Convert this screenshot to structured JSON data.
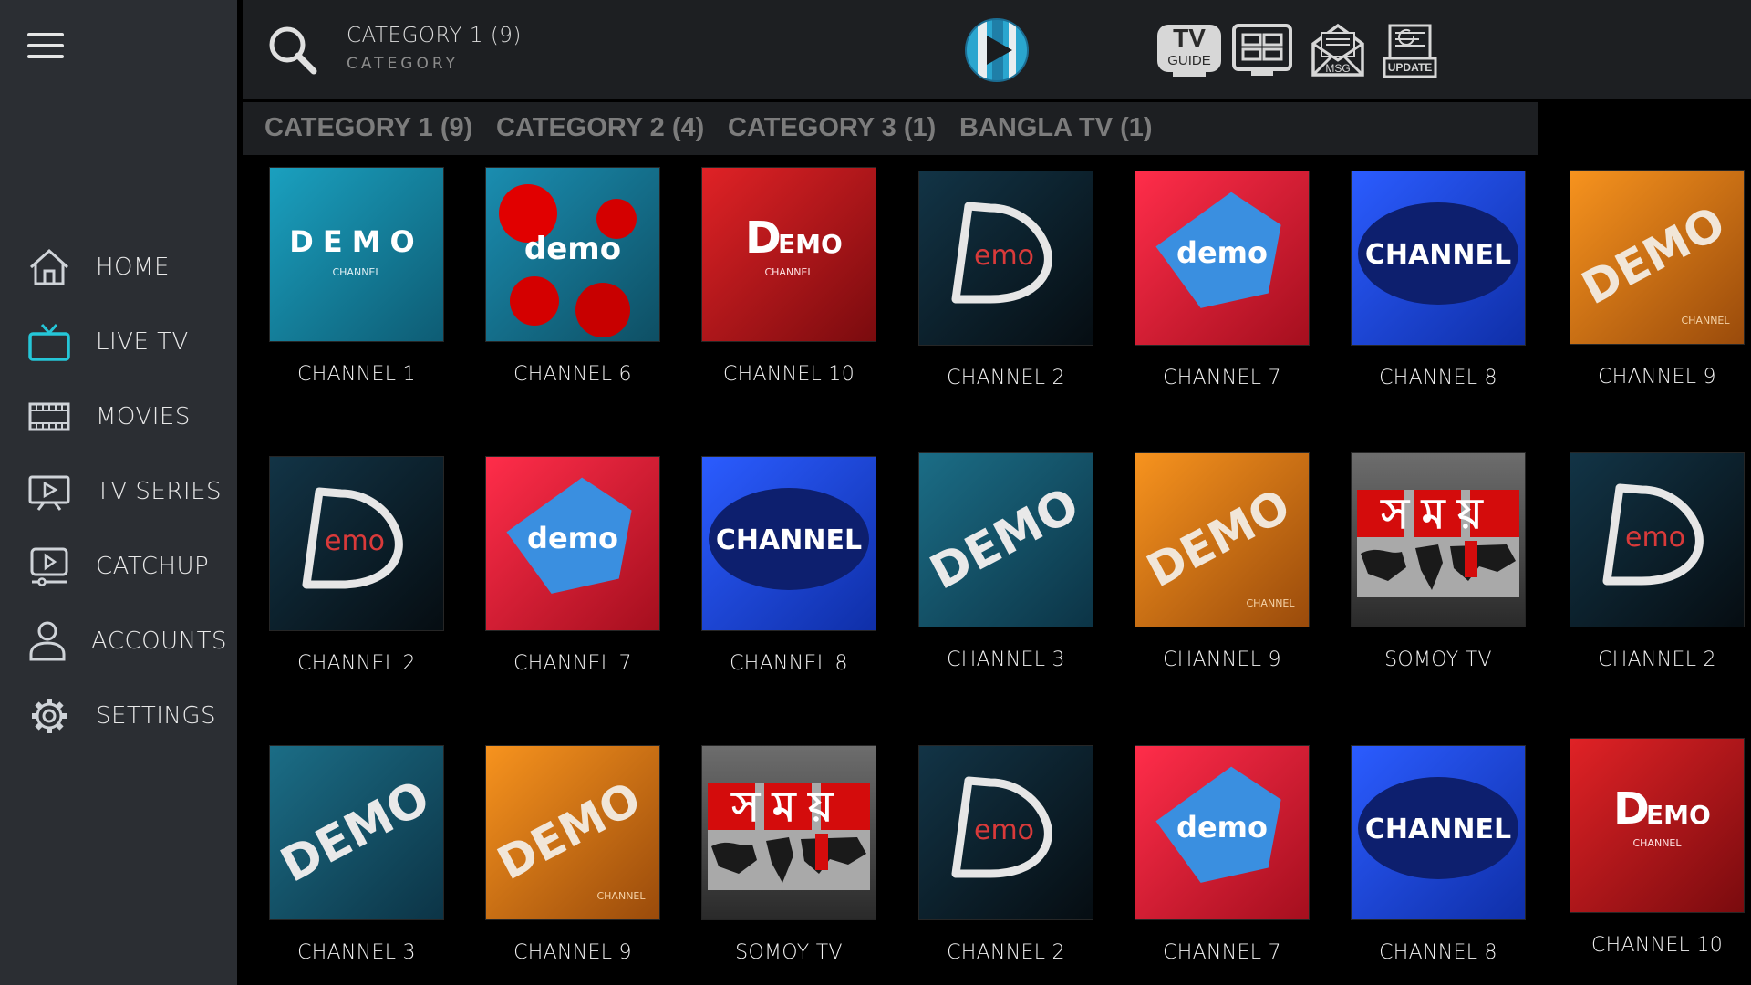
{
  "header": {
    "title": "CATEGORY 1 (9)",
    "subtitle": "CATEGORY",
    "actions": [
      {
        "name": "tv-guide",
        "label_top": "TV",
        "label_bottom": "GUIDE",
        "icon": "tv-guide-icon"
      },
      {
        "name": "multiscreen",
        "icon": "multiscreen-icon"
      },
      {
        "name": "messages",
        "label": "MSG",
        "icon": "mail-icon"
      },
      {
        "name": "update",
        "label": "UPDATE",
        "icon": "update-icon"
      }
    ]
  },
  "sidebar": {
    "items": [
      {
        "label": "HOME",
        "icon": "home-icon"
      },
      {
        "label": "LIVE TV",
        "icon": "tv-icon",
        "active": true
      },
      {
        "label": "MOVIES",
        "icon": "film-icon"
      },
      {
        "label": "TV SERIES",
        "icon": "series-icon"
      },
      {
        "label": "CATCHUP",
        "icon": "catchup-icon"
      },
      {
        "label": "ACCOUNTS",
        "icon": "user-icon"
      },
      {
        "label": "SETTINGS",
        "icon": "gear-icon"
      }
    ]
  },
  "categories": [
    "CATEGORY 1 (9)",
    "CATEGORY 2 (4)",
    "CATEGORY 3 (1)",
    "BANGLA TV (1)"
  ],
  "colors": {
    "accent": "#25c6d8",
    "sidebar_bg": "#2b2e33",
    "topbar_bg": "#1d1f22",
    "tab_text": "#7c7c7c"
  },
  "logo_text": {
    "demo_spaced": "DEMO",
    "demo_lower": "demo",
    "demo_first": "D",
    "demo_rest": "EMO",
    "emo": "emo",
    "channel_upper": "CHANNEL",
    "channel_small": "CHANNEL",
    "somoy": "সময়"
  },
  "channels": [
    {
      "name": "CHANNEL 1",
      "art": "teal-spaced"
    },
    {
      "name": "CHANNEL 6",
      "art": "teal-dots"
    },
    {
      "name": "CHANNEL 10",
      "art": "red-demo"
    },
    {
      "name": "CHANNEL 2",
      "art": "dark-d"
    },
    {
      "name": "CHANNEL 7",
      "art": "red-pentagon"
    },
    {
      "name": "CHANNEL 8",
      "art": "blue-ellipse"
    },
    {
      "name": "CHANNEL 9",
      "art": "orange-diag"
    },
    {
      "name": "CHANNEL 2",
      "art": "dark-d"
    },
    {
      "name": "CHANNEL 7",
      "art": "red-pentagon"
    },
    {
      "name": "CHANNEL 8",
      "art": "blue-ellipse"
    },
    {
      "name": "CHANNEL 3",
      "art": "teal-diag"
    },
    {
      "name": "CHANNEL 9",
      "art": "orange-diag"
    },
    {
      "name": "SOMOY TV",
      "art": "somoy"
    },
    {
      "name": "CHANNEL 2",
      "art": "dark-d"
    },
    {
      "name": "CHANNEL 3",
      "art": "teal-diag"
    },
    {
      "name": "CHANNEL 9",
      "art": "orange-diag"
    },
    {
      "name": "SOMOY TV",
      "art": "somoy"
    },
    {
      "name": "CHANNEL 2",
      "art": "dark-d"
    },
    {
      "name": "CHANNEL 7",
      "art": "red-pentagon"
    },
    {
      "name": "CHANNEL 8",
      "art": "blue-ellipse"
    },
    {
      "name": "CHANNEL 10",
      "art": "red-demo"
    }
  ]
}
